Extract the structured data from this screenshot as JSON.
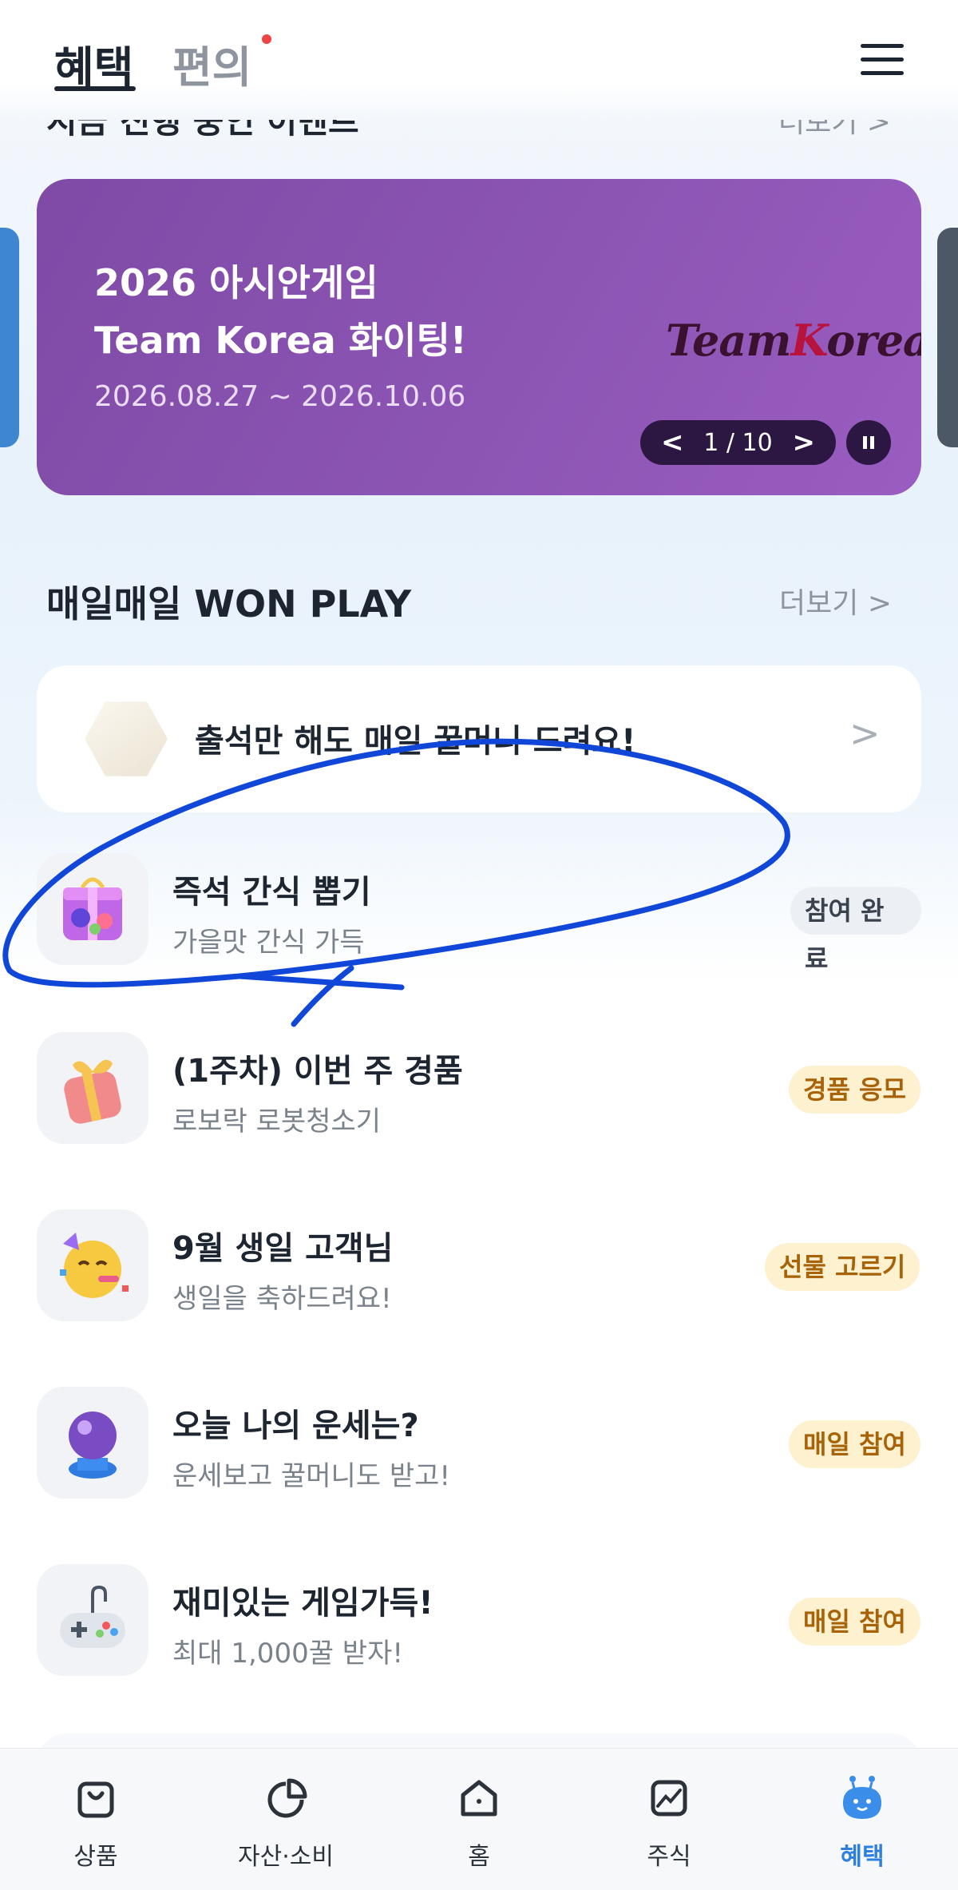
{
  "header": {
    "tab_active": "혜택",
    "tab_other": "편의",
    "menu_icon": "hamburger-menu-icon"
  },
  "prev_section": {
    "title": "지금 진행 중인 이벤트",
    "more": "더보기 >"
  },
  "banner": {
    "line1": "2026 아시안게임",
    "line2": "Team Korea 화이팅!",
    "date": "2026.08.27 ~ 2026.10.06",
    "logo_part1": "Team",
    "logo_k": "K",
    "logo_part2": "orea",
    "pager_prev": "<",
    "pager_text": "1 / 10",
    "pager_next": ">",
    "colors": {
      "bg": "#8c55b4",
      "pager_bg": "#2b1742"
    }
  },
  "won_play": {
    "title": "매일매일 WON PLAY",
    "more": "더보기",
    "more_arrow": ">",
    "attendance": {
      "text": "출석만 해도 매일 꿀머니 드려요!",
      "arrow": ">"
    },
    "items": [
      {
        "title": "즉석 간식 뽑기",
        "subtitle": "가을맛 간식 가득",
        "badge": "참여 완료",
        "icon": "gift-capsule-icon",
        "badge_style": "done"
      },
      {
        "title": "(1주차) 이번 주 경품",
        "subtitle": "로보락 로봇청소기",
        "badge": "경품 응모",
        "icon": "gift-box-icon",
        "badge_style": "yellow"
      },
      {
        "title": "9월 생일 고객님",
        "subtitle": "생일을 축하드려요!",
        "badge": "선물 고르기",
        "icon": "party-face-icon",
        "badge_style": "yellow"
      },
      {
        "title": "오늘 나의 운세는?",
        "subtitle": "운세보고 꿀머니도 받고!",
        "badge": "매일 참여",
        "icon": "crystal-ball-icon",
        "badge_style": "yellow"
      },
      {
        "title": "재미있는 게임가득!",
        "subtitle": "최대 1,000꿀 받자!",
        "badge": "매일 참여",
        "icon": "game-controller-icon",
        "badge_style": "yellow"
      }
    ]
  },
  "bottom_nav": [
    {
      "label": "상품",
      "icon": "shopping-bag-icon"
    },
    {
      "label": "자산·소비",
      "icon": "pie-chart-icon"
    },
    {
      "label": "홈",
      "icon": "home-icon"
    },
    {
      "label": "주식",
      "icon": "stock-chart-icon"
    },
    {
      "label": "혜택",
      "icon": "benefit-mascot-icon",
      "active": true
    }
  ],
  "colors": {
    "annotation_stroke": "#1147d9",
    "active_nav": "#2d7fe0",
    "badge_yellow_bg": "#fdf1cf",
    "badge_yellow_text": "#a86208"
  }
}
